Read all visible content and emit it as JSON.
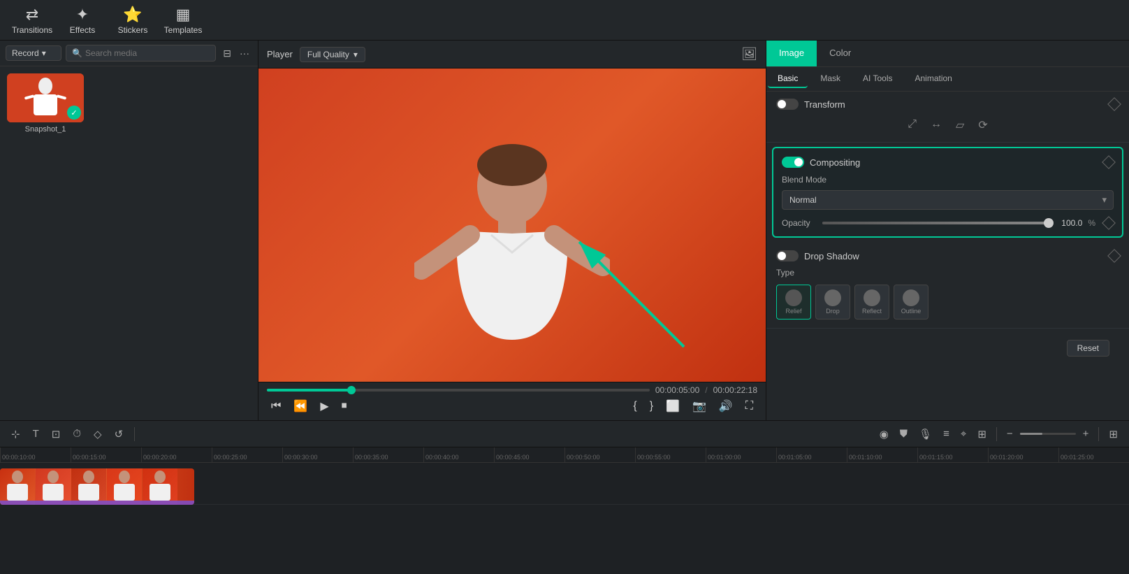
{
  "toolbar": {
    "transitions_label": "Transitions",
    "effects_label": "Effects",
    "stickers_label": "Stickers",
    "templates_label": "Templates"
  },
  "left_panel": {
    "record_dropdown": "Record",
    "search_placeholder": "Search media",
    "media_items": [
      {
        "name": "Snapshot_1",
        "has_check": true
      }
    ]
  },
  "player": {
    "label": "Player",
    "quality": "Full Quality",
    "time_current": "00:00:05:00",
    "time_total": "00:00:22:18",
    "progress_percent": 22
  },
  "right_panel": {
    "tabs": [
      "Image",
      "Color"
    ],
    "active_tab": "Image",
    "sub_tabs": [
      "Basic",
      "Mask",
      "AI Tools",
      "Animation"
    ],
    "active_sub_tab": "Basic",
    "transform": {
      "label": "Transform",
      "enabled": false
    },
    "compositing": {
      "label": "Compositing",
      "enabled": true,
      "blend_mode_label": "Blend Mode",
      "blend_mode_value": "Normal",
      "opacity_label": "Opacity",
      "opacity_value": "100.0",
      "opacity_unit": "%"
    },
    "drop_shadow": {
      "label": "Drop Shadow",
      "enabled": false,
      "type_label": "Type",
      "types": [
        "Relief",
        "Drop",
        "Reflect",
        "Outline"
      ],
      "active_type": "Relief"
    },
    "reset_button": "Reset"
  },
  "timeline": {
    "tools": [
      "select",
      "text",
      "crop",
      "timer",
      "shape",
      "rotate"
    ],
    "zoom_minus": "−",
    "zoom_plus": "+",
    "ruler_marks": [
      "00:00:10:00",
      "00:00:15:00",
      "00:00:20:00",
      "00:00:25:00",
      "00:00:30:00",
      "00:00:35:00",
      "00:00:40:00",
      "00:00:45:00",
      "00:00:50:00",
      "00:00:55:00",
      "00:01:00:00",
      "00:01:05:00",
      "00:01:10:00",
      "00:01:15:00",
      "00:01:20:00",
      "00:01:25:00"
    ]
  }
}
